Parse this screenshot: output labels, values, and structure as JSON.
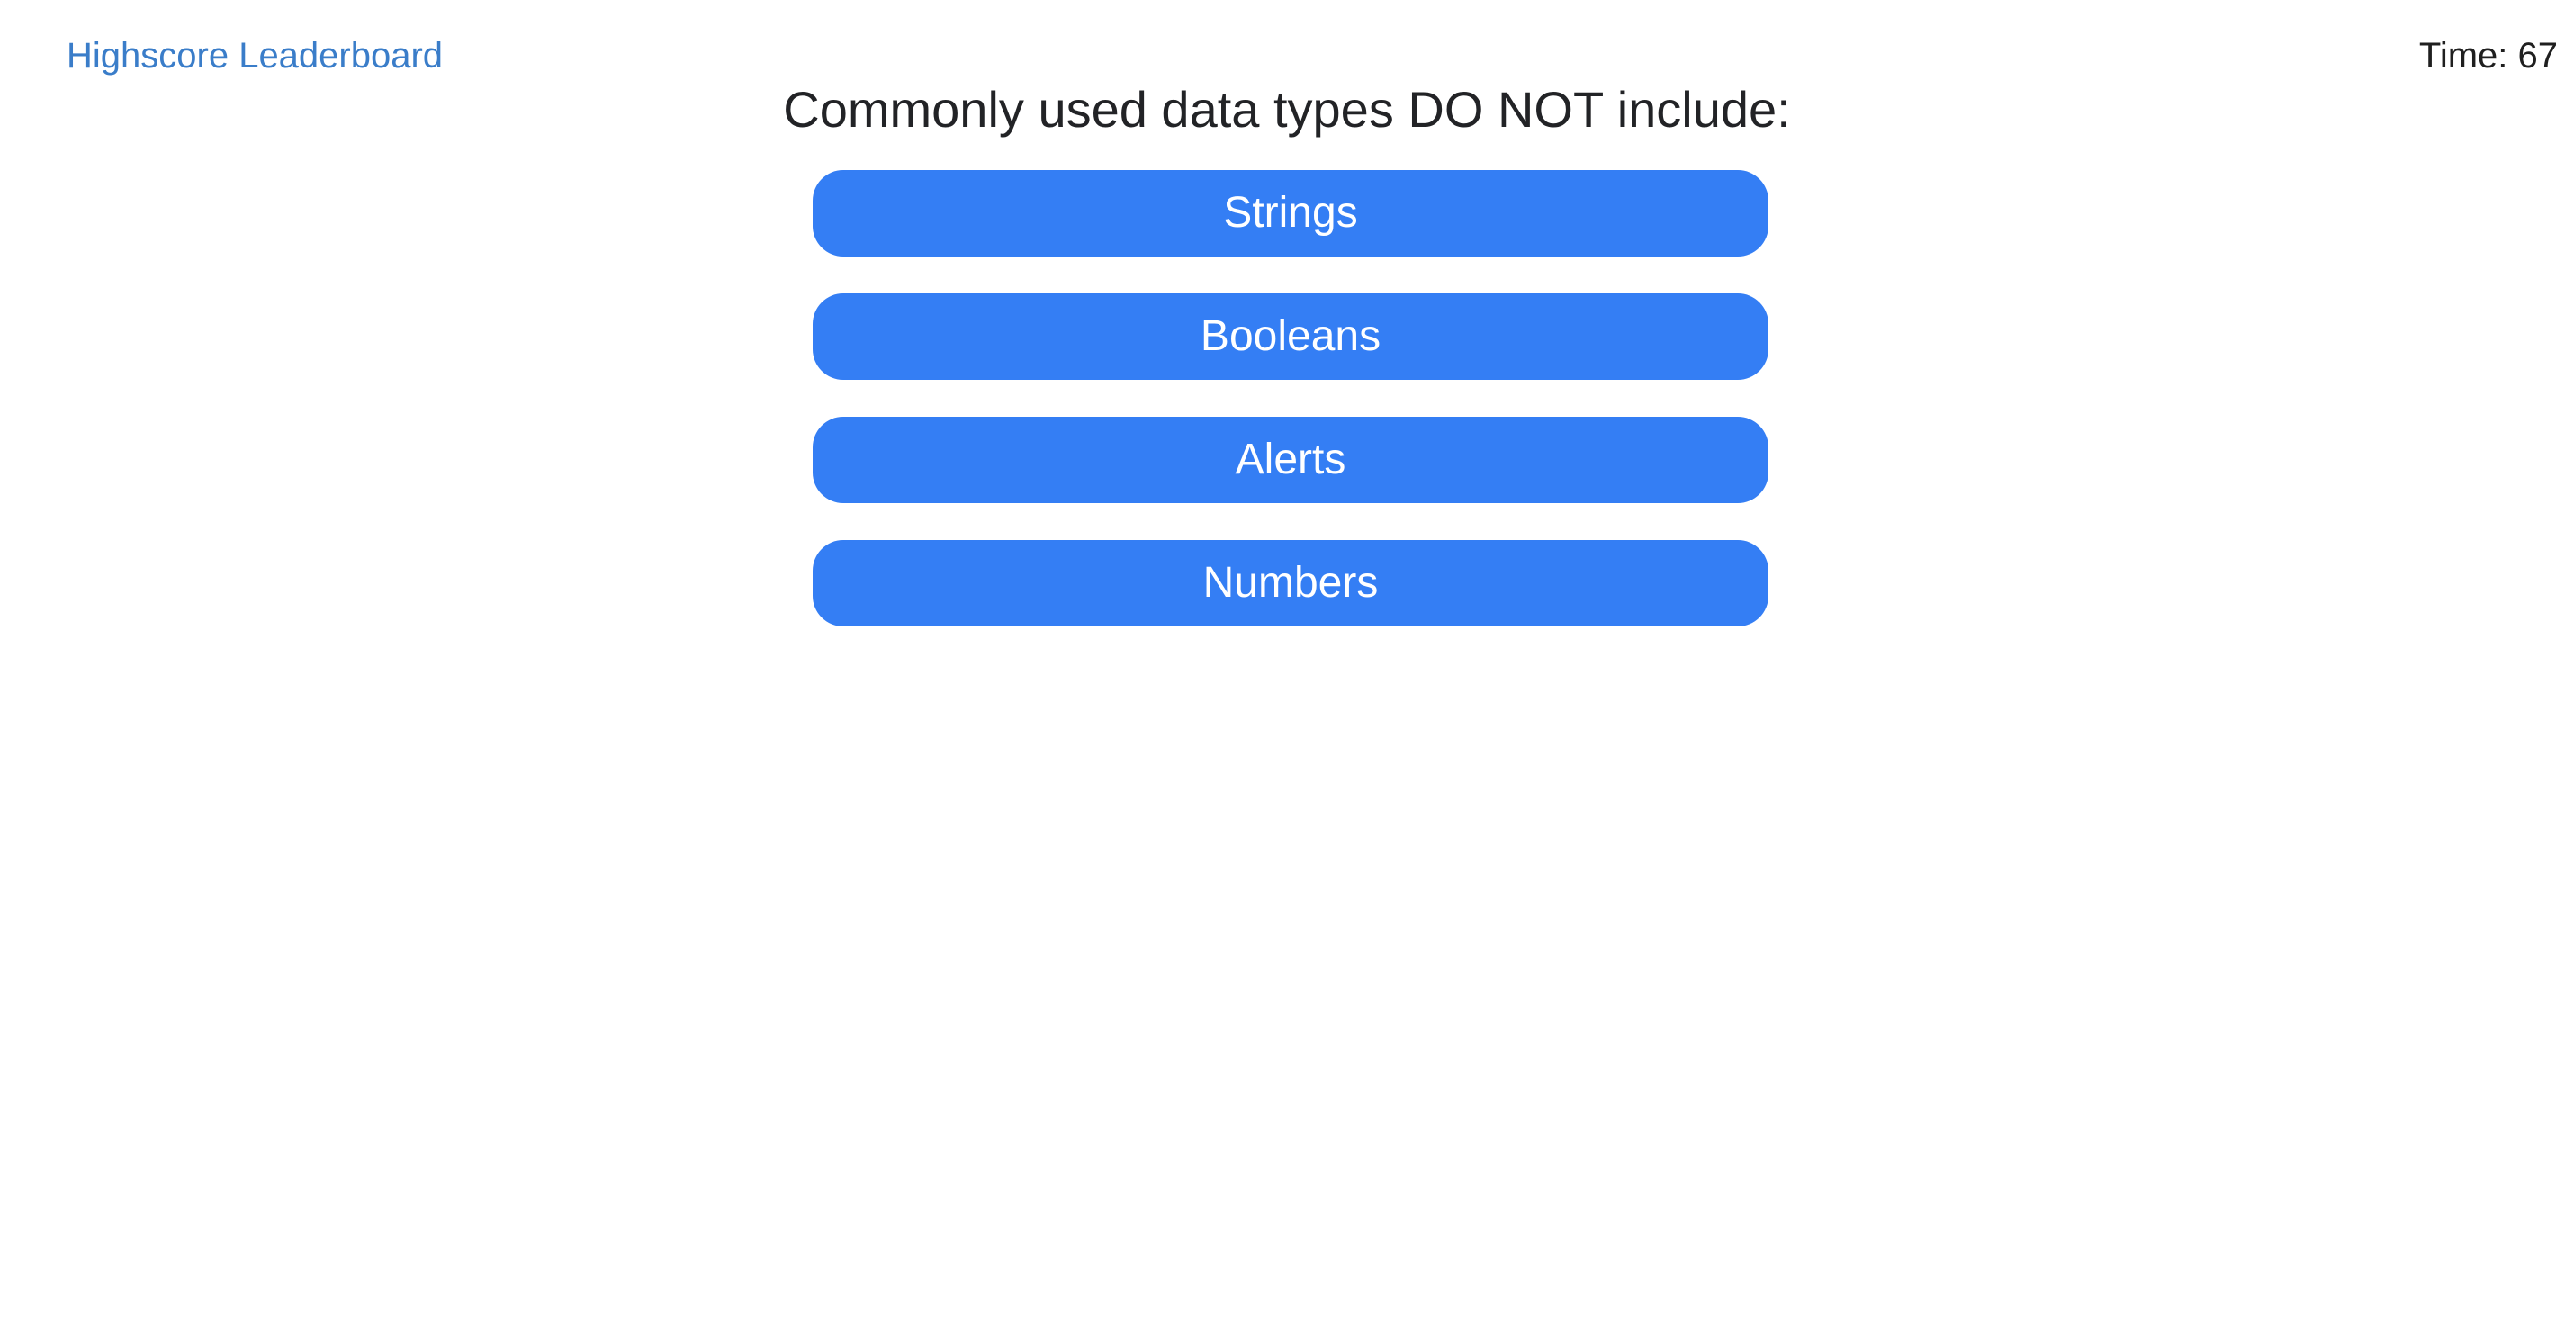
{
  "header": {
    "leaderboard_link": "Highscore Leaderboard",
    "timer_label": "Time: 67"
  },
  "quiz": {
    "question": "Commonly used data types DO NOT include:",
    "answers": [
      {
        "label": "Strings"
      },
      {
        "label": "Booleans"
      },
      {
        "label": "Alerts"
      },
      {
        "label": "Numbers"
      }
    ]
  },
  "colors": {
    "accent": "#347ef4",
    "link": "#3a7dc9",
    "text": "#222326",
    "background": "#ffffff"
  }
}
